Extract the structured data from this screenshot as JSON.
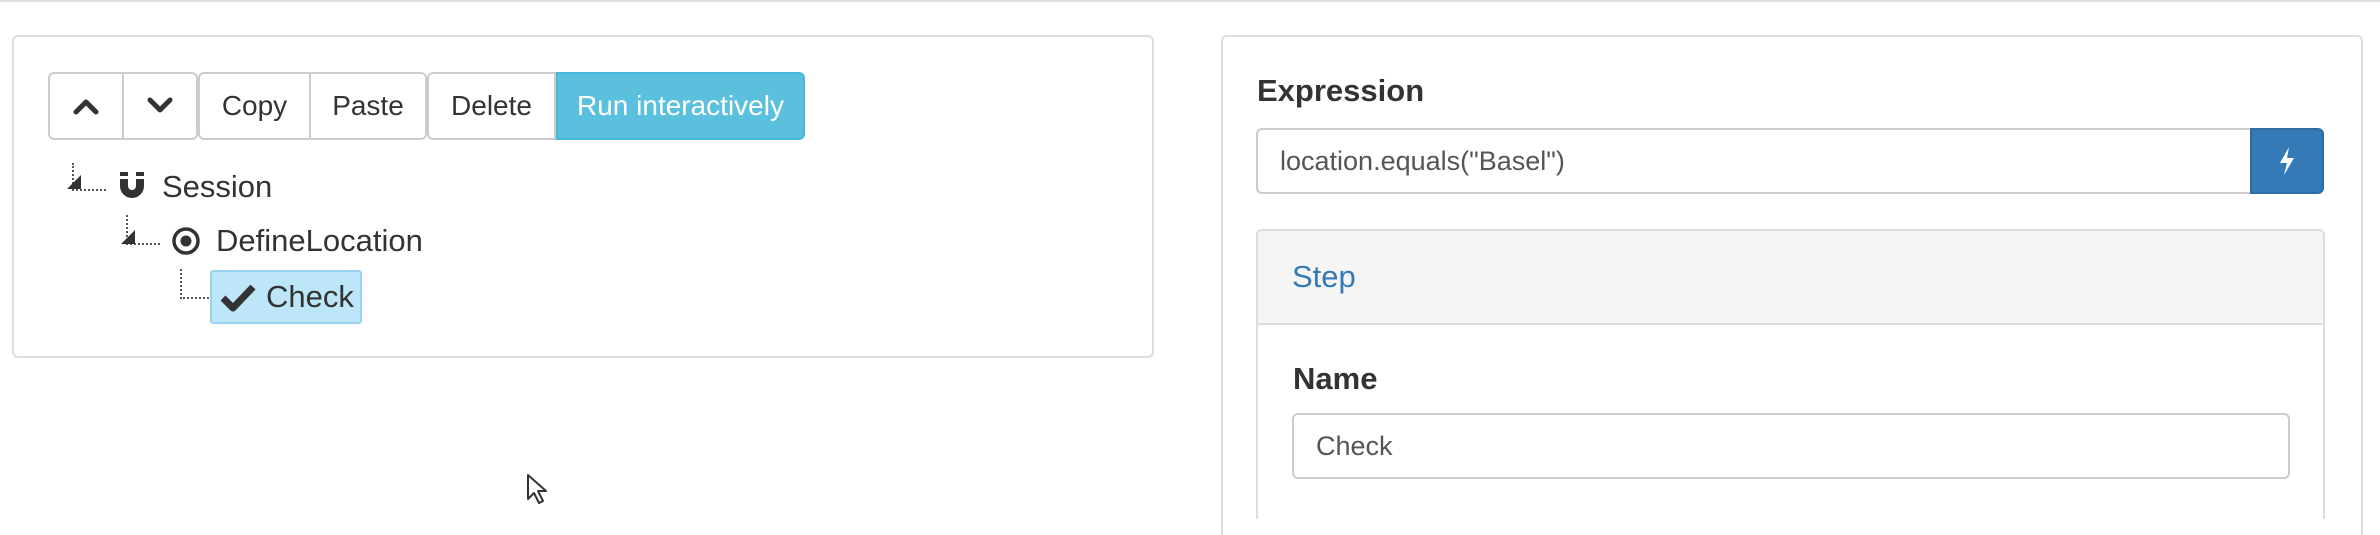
{
  "toolbar": {
    "up_icon": "chevron-up-icon",
    "down_icon": "chevron-down-icon",
    "copy_label": "Copy",
    "paste_label": "Paste",
    "delete_label": "Delete",
    "run_label": "Run interactively"
  },
  "tree": {
    "nodes": [
      {
        "label": "Session",
        "icon": "magnet-icon",
        "selected": false
      },
      {
        "label": "DefineLocation",
        "icon": "target-icon",
        "selected": false
      },
      {
        "label": "Check",
        "icon": "checkmark-icon",
        "selected": true
      }
    ]
  },
  "editor": {
    "expression_label": "Expression",
    "expression_value": "location.equals(\"Basel\")",
    "evaluate_icon": "lightning-bolt-icon",
    "step_title": "Step",
    "name_label": "Name",
    "name_value": "Check"
  },
  "colors": {
    "run_button": "#5bc0de",
    "bolt_button": "#337ab7",
    "selected_node": "#bde6f8",
    "link_blue": "#337ab7"
  }
}
